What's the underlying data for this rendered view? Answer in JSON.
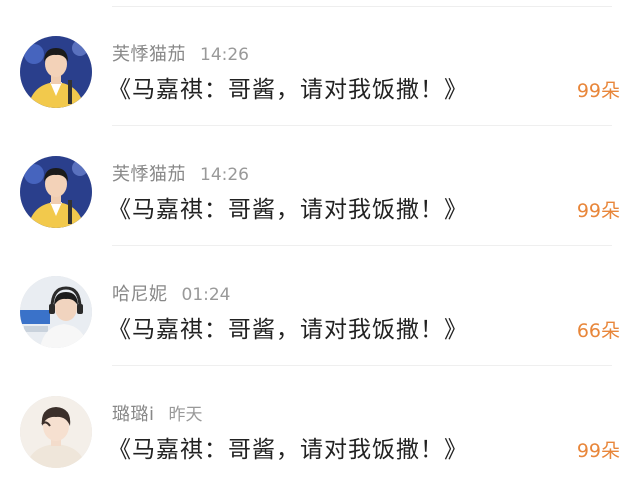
{
  "comments": [
    {
      "avatar_icon": "avatar-boy-yellow-jacket-icon",
      "username": "芙悸猫茄",
      "time": "14:26",
      "message": "《马嘉祺：哥酱，请对我饭撒！》",
      "count": "99朵"
    },
    {
      "avatar_icon": "avatar-boy-yellow-jacket-icon",
      "username": "芙悸猫茄",
      "time": "14:26",
      "message": "《马嘉祺：哥酱，请对我饭撒！》",
      "count": "99朵"
    },
    {
      "avatar_icon": "avatar-boy-headphones-icon",
      "username": "哈尼妮",
      "time": "01:24",
      "message": "《马嘉祺：哥酱，请对我饭撒！》",
      "count": "66朵"
    },
    {
      "avatar_icon": "avatar-boy-light-portrait-icon",
      "username": "璐璐i",
      "time": "昨天",
      "message": "《马嘉祺：哥酱，请对我饭撒！》",
      "count": "99朵"
    }
  ],
  "colors": {
    "count": "#e8863a",
    "username": "#888888",
    "message": "#222222"
  }
}
